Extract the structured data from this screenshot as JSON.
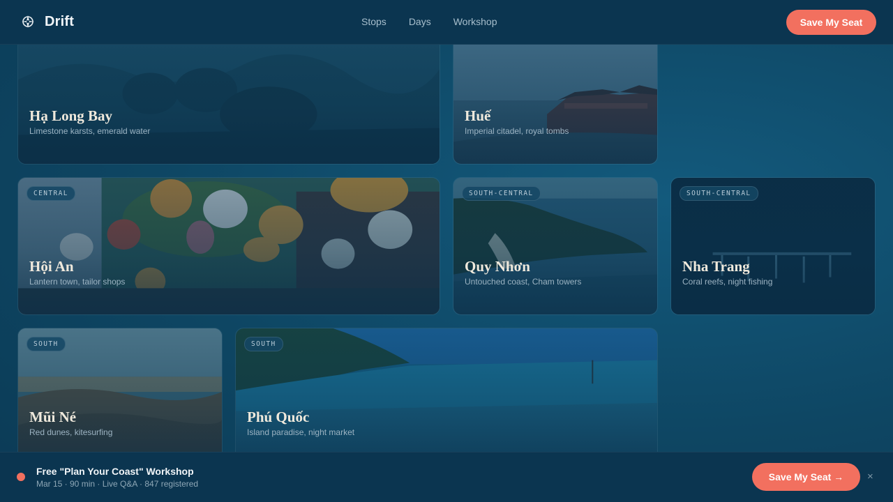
{
  "header": {
    "brand": "Drift",
    "nav": [
      "Stops",
      "Days",
      "Workshop"
    ],
    "cta": "Save My Seat"
  },
  "cards": [
    {
      "region": "",
      "title": "Hạ Long Bay",
      "subtitle": "Limestone karsts, emerald water"
    },
    {
      "region": "",
      "title": "Huế",
      "subtitle": "Imperial citadel, royal tombs"
    },
    {
      "region": "CENTRAL",
      "title": "Hội An",
      "subtitle": "Lantern town, tailor shops"
    },
    {
      "region": "SOUTH-CENTRAL",
      "title": "Quy Nhơn",
      "subtitle": "Untouched coast, Cham towers"
    },
    {
      "region": "SOUTH-CENTRAL",
      "title": "Nha Trang",
      "subtitle": "Coral reefs, night fishing"
    },
    {
      "region": "SOUTH",
      "title": "Mũi Né",
      "subtitle": "Red dunes, kitesurfing"
    },
    {
      "region": "SOUTH",
      "title": "Phú Quốc",
      "subtitle": "Island paradise, night market"
    }
  ],
  "banner": {
    "title": "Free \"Plan Your Coast\" Workshop",
    "meta": "Mar 15 · 90 min · Live Q&A · 847 registered",
    "cta": "Save My Seat →",
    "close": "×"
  },
  "colors": {
    "accent": "#f2705f",
    "bar": "#0b3550",
    "page": "#0f4564"
  }
}
